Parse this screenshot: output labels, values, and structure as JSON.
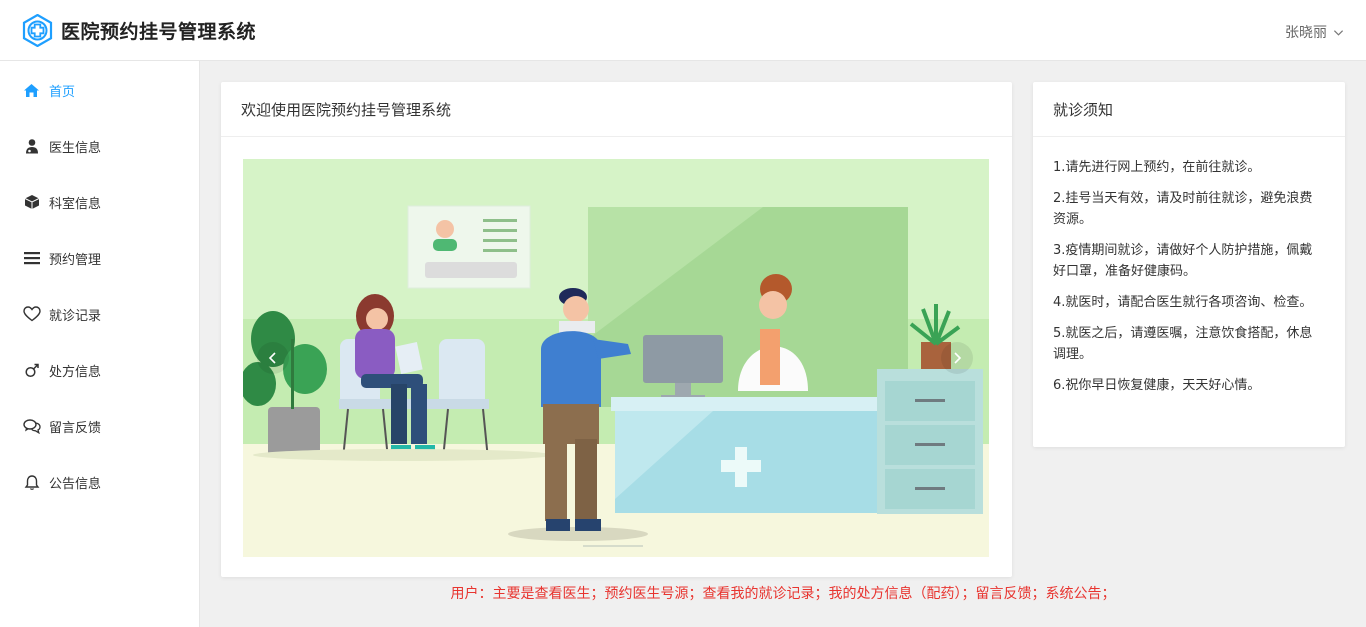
{
  "header": {
    "app_title": "医院预约挂号管理系统",
    "user_name": "张晓丽"
  },
  "sidebar": {
    "items": [
      {
        "label": "首页",
        "icon": "home-icon",
        "active": true
      },
      {
        "label": "医生信息",
        "icon": "doctor-icon"
      },
      {
        "label": "科室信息",
        "icon": "cube-icon"
      },
      {
        "label": "预约管理",
        "icon": "list-icon"
      },
      {
        "label": "就诊记录",
        "icon": "heart-icon"
      },
      {
        "label": "处方信息",
        "icon": "male-icon"
      },
      {
        "label": "留言反馈",
        "icon": "chat-icon"
      },
      {
        "label": "公告信息",
        "icon": "bell-icon"
      }
    ]
  },
  "main": {
    "welcome_title": "欢迎使用医院预约挂号管理系统"
  },
  "notice": {
    "title": "就诊须知",
    "items": [
      "1.请先进行网上预约，在前往就诊。",
      "2.挂号当天有效，请及时前往就诊，避免浪费资源。",
      "3.疫情期间就诊，请做好个人防护措施，佩戴好口罩，准备好健康码。",
      "4.就医时，请配合医生就行各项咨询、检查。",
      "5.就医之后，请遵医嘱，注意饮食搭配，休息调理。",
      "6.祝你早日恢复健康，天天好心情。"
    ]
  },
  "footer_note": "用户：主要是查看医生；预约医生号源；查看我的就诊记录；我的处方信息（配药）；留言反馈；系统公告；",
  "colors": {
    "accent": "#1e9fff",
    "note_red": "#e8342f"
  }
}
